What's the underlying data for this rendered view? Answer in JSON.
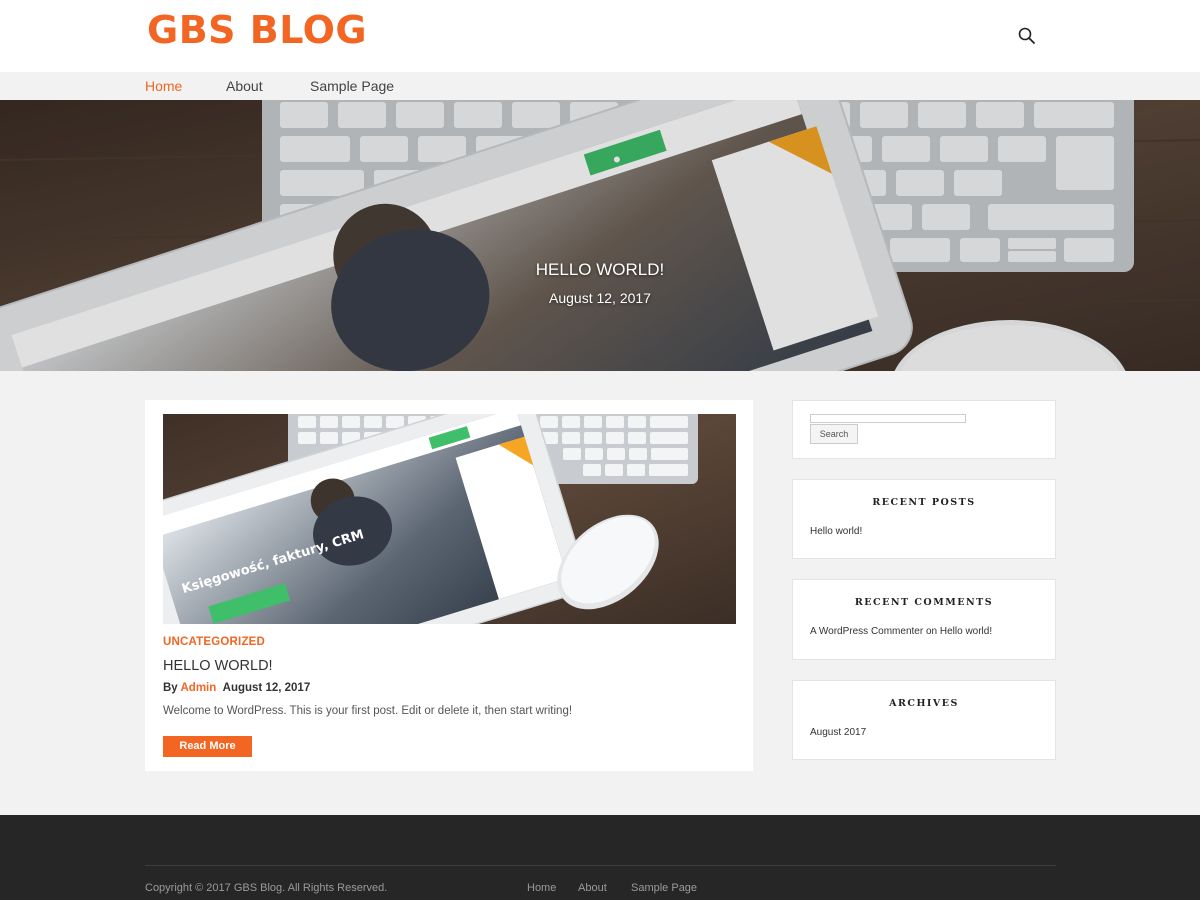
{
  "site": {
    "title": "GBS BLOG"
  },
  "nav": {
    "items": [
      "Home",
      "About",
      "Sample Page"
    ],
    "active": "Home"
  },
  "hero": {
    "title": "HELLO WORLD!",
    "date": "August 12, 2017"
  },
  "post": {
    "category": "UNCATEGORIZED",
    "title": "HELLO WORLD!",
    "by_label": "By",
    "author": "Admin",
    "date": "August 12, 2017",
    "excerpt": "Welcome to WordPress. This is your first post. Edit or delete it, then start writing!",
    "read_more": "Read More"
  },
  "sidebar": {
    "search_button": "Search",
    "recent_posts": {
      "title": "RECENT POSTS",
      "items": [
        "Hello world!"
      ]
    },
    "recent_comments": {
      "title": "RECENT COMMENTS",
      "author": "A WordPress Commenter",
      "on": "on",
      "post": "Hello world!"
    },
    "archives": {
      "title": "ARCHIVES",
      "items": [
        "August 2017"
      ]
    }
  },
  "footer": {
    "copyright": "Copyright © 2017 GBS Blog. All Rights Reserved.",
    "links": [
      "Home",
      "About",
      "Sample Page"
    ]
  },
  "colors": {
    "accent": "#f26522",
    "footer": "#262626",
    "background": "#f2f2f2"
  },
  "icons": {
    "search": "search-icon"
  }
}
